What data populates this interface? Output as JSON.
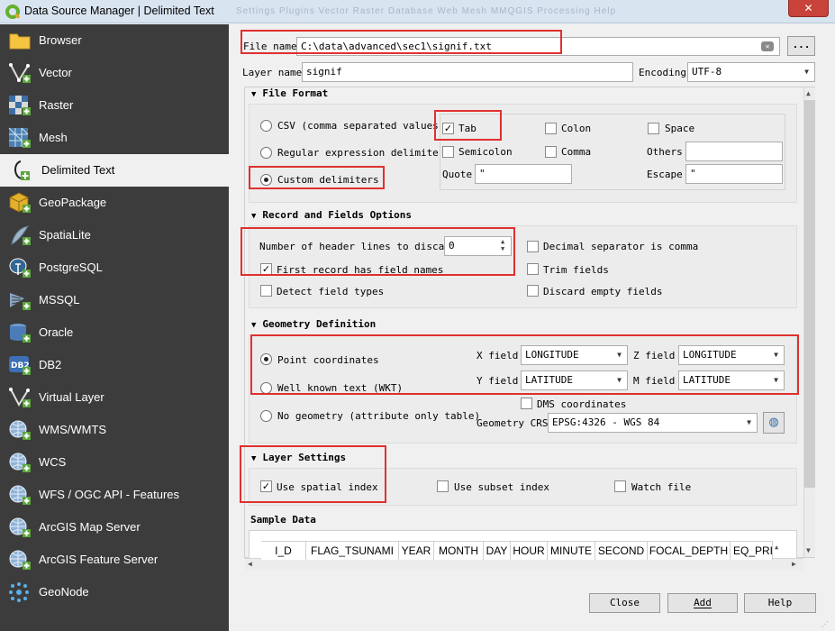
{
  "window": {
    "title": "Data Source Manager | Delimited Text",
    "close_glyph": "✕",
    "ghost_menu": "Settings   Plugins   Vector   Raster   Database   Web   Mesh   MMQGIS   Processing   Help"
  },
  "sidebar": {
    "items": [
      {
        "label": "Browser",
        "icon": "folder-icon"
      },
      {
        "label": "Vector",
        "icon": "vector-icon"
      },
      {
        "label": "Raster",
        "icon": "raster-icon"
      },
      {
        "label": "Mesh",
        "icon": "mesh-icon"
      },
      {
        "label": "Delimited Text",
        "icon": "delimited-text-icon"
      },
      {
        "label": "GeoPackage",
        "icon": "geopackage-icon"
      },
      {
        "label": "SpatiaLite",
        "icon": "spatialite-icon"
      },
      {
        "label": "PostgreSQL",
        "icon": "postgresql-icon"
      },
      {
        "label": "MSSQL",
        "icon": "mssql-icon"
      },
      {
        "label": "Oracle",
        "icon": "oracle-icon"
      },
      {
        "label": "DB2",
        "icon": "db2-icon"
      },
      {
        "label": "Virtual Layer",
        "icon": "virtual-layer-icon"
      },
      {
        "label": "WMS/WMTS",
        "icon": "wms-icon"
      },
      {
        "label": "WCS",
        "icon": "wcs-icon"
      },
      {
        "label": "WFS / OGC API - Features",
        "icon": "wfs-icon"
      },
      {
        "label": "ArcGIS Map Server",
        "icon": "arcgis-map-icon"
      },
      {
        "label": "ArcGIS Feature Server",
        "icon": "arcgis-feature-icon"
      },
      {
        "label": "GeoNode",
        "icon": "geonode-icon"
      }
    ],
    "selected": "Delimited Text",
    "db2_badge": "DB2"
  },
  "file": {
    "label": "File name",
    "value": "C:\\data\\advanced\\sec1\\signif.txt",
    "browse": "...",
    "clear_glyph": "⌫"
  },
  "layer": {
    "label": "Layer name",
    "value": "signif",
    "encoding_label": "Encoding",
    "encoding": "UTF-8"
  },
  "file_format": {
    "title": "File Format",
    "csv": "CSV (comma separated values)",
    "regex": "Regular expression delimiter",
    "custom": "Custom delimiters",
    "tab": "Tab",
    "colon": "Colon",
    "space": "Space",
    "semicolon": "Semicolon",
    "comma": "Comma",
    "others": "Others",
    "quote_label": "Quote",
    "quote_value": "\"",
    "escape_label": "Escape",
    "escape_value": "\""
  },
  "record": {
    "title": "Record and Fields Options",
    "header_lines_label": "Number of header lines to discard",
    "header_lines_value": "0",
    "decimal_comma": "Decimal separator is comma",
    "first_record": "First record has field names",
    "trim": "Trim fields",
    "detect": "Detect field types",
    "discard_empty": "Discard empty fields"
  },
  "geometry": {
    "title": "Geometry Definition",
    "point": "Point coordinates",
    "wkt": "Well known text (WKT)",
    "none": "No geometry (attribute only table)",
    "x_label": "X field",
    "x_value": "LONGITUDE",
    "y_label": "Y field",
    "y_value": "LATITUDE",
    "z_label": "Z field",
    "z_value": "LONGITUDE",
    "m_label": "M field",
    "m_value": "LATITUDE",
    "dms": "DMS coordinates",
    "crs_label": "Geometry CRS",
    "crs_value": "EPSG:4326 - WGS 84"
  },
  "layer_settings": {
    "title": "Layer Settings",
    "spatial_index": "Use spatial index",
    "subset_index": "Use subset index",
    "watch": "Watch file"
  },
  "sample": {
    "title": "Sample Data",
    "columns": [
      "I_D",
      "FLAG_TSUNAMI",
      "YEAR",
      "MONTH",
      "DAY",
      "HOUR",
      "MINUTE",
      "SECOND",
      "FOCAL_DEPTH",
      "EQ_PRI"
    ]
  },
  "buttons": {
    "close": "Close",
    "add": "Add",
    "help": "Help"
  },
  "colors": {
    "sidebar_bg": "#3c3c3c",
    "highlight": "#e0302f",
    "title_bar": "#d9e4f1"
  }
}
